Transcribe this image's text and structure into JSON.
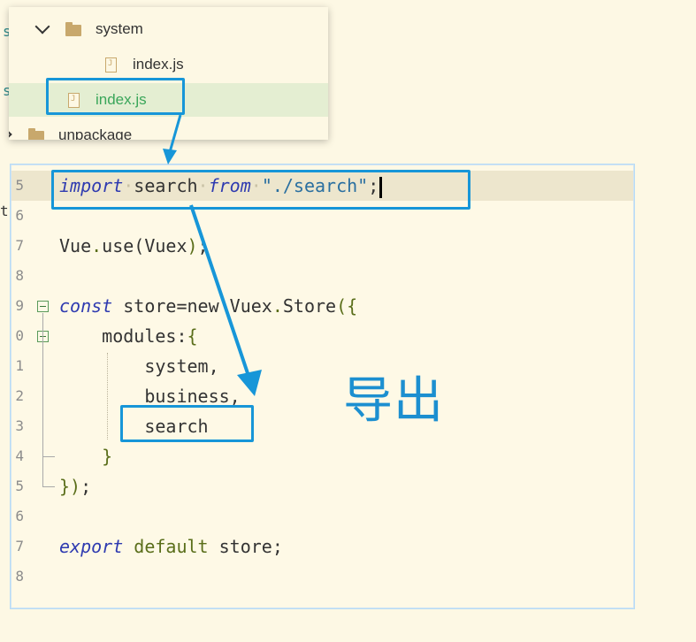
{
  "file_tree": {
    "items": [
      {
        "label": "system",
        "kind": "folder",
        "expanded": true
      },
      {
        "label": "index.js",
        "kind": "file"
      },
      {
        "label": "index.js",
        "kind": "file",
        "selected": true
      },
      {
        "label": "unpackage",
        "kind": "folder"
      }
    ]
  },
  "editor": {
    "lines": [
      {
        "n": "5",
        "tokens": [
          [
            "kw",
            "import"
          ],
          [
            "ws",
            "·"
          ],
          [
            "p",
            "search"
          ],
          [
            "ws",
            "·"
          ],
          [
            "kw",
            "from"
          ],
          [
            "ws",
            "·"
          ],
          [
            "str",
            "\"./search\""
          ],
          [
            "p",
            ";"
          ]
        ]
      },
      {
        "n": "6",
        "tokens": []
      },
      {
        "n": "7",
        "tokens": [
          [
            "p",
            "Vue"
          ],
          [
            "grn",
            "."
          ],
          [
            "p",
            "use(Vuex"
          ],
          [
            "grn",
            ")"
          ],
          [
            "p",
            ";"
          ]
        ]
      },
      {
        "n": "8",
        "tokens": []
      },
      {
        "n": "9",
        "tokens": [
          [
            "kw",
            "const"
          ],
          [
            "p",
            " store=new Vuex"
          ],
          [
            "grn",
            "."
          ],
          [
            "p",
            "Store"
          ],
          [
            "grn",
            "({"
          ]
        ]
      },
      {
        "n": "0",
        "tokens": [
          [
            "p",
            "    modules:"
          ],
          [
            "grn",
            "{"
          ]
        ]
      },
      {
        "n": "1",
        "tokens": [
          [
            "p",
            "        system,"
          ]
        ]
      },
      {
        "n": "2",
        "tokens": [
          [
            "p",
            "        business,"
          ]
        ]
      },
      {
        "n": "3",
        "tokens": [
          [
            "p",
            "        search"
          ]
        ]
      },
      {
        "n": "4",
        "tokens": [
          [
            "grn",
            "    }"
          ]
        ]
      },
      {
        "n": "5",
        "tokens": [
          [
            "grn",
            "})"
          ],
          [
            "p",
            ";"
          ]
        ]
      },
      {
        "n": "6",
        "tokens": []
      },
      {
        "n": "7",
        "tokens": [
          [
            "kw",
            "export"
          ],
          [
            "p",
            " "
          ],
          [
            "grn",
            "default"
          ],
          [
            "p",
            " store;"
          ]
        ]
      },
      {
        "n": "8",
        "tokens": []
      }
    ]
  },
  "annotation": {
    "callout_text": "导出",
    "color": "#1796d8"
  },
  "background_fragments": [
    "s",
    "s",
    "s",
    "t"
  ]
}
